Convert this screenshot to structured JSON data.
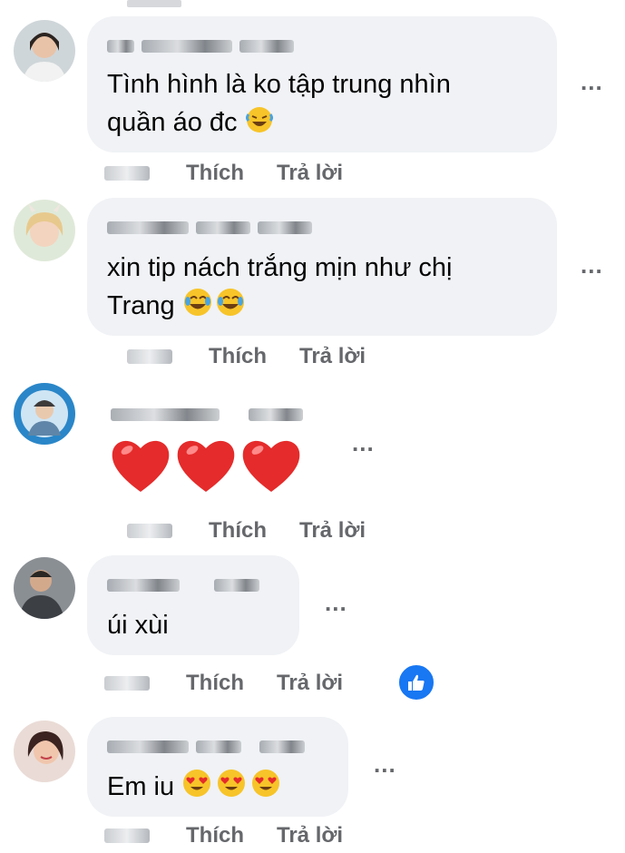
{
  "comments": [
    {
      "text_lines": [
        "Tình hình là ko tập trung nhìn",
        "quần áo đc"
      ],
      "emoji_end": "rofl",
      "actions": {
        "like": "Thích",
        "reply": "Trả lời"
      }
    },
    {
      "text_lines": [
        "xin tip nách trắng mịn như chị",
        "Trang"
      ],
      "emoji_end": "joy joy",
      "actions": {
        "like": "Thích",
        "reply": "Trả lời"
      }
    },
    {
      "text_lines": [],
      "emoji_end": "three hearts",
      "actions": {
        "like": "Thích",
        "reply": "Trả lời"
      }
    },
    {
      "text_lines": [
        "úi xùi"
      ],
      "actions": {
        "like": "Thích",
        "reply": "Trả lời"
      },
      "reaction": "like-icon"
    },
    {
      "text_lines": [
        "Em iu"
      ],
      "emoji_end": "three heart-eyes",
      "actions": {
        "like": "Thích",
        "reply": "Trả lời"
      }
    }
  ],
  "more_label": "...",
  "colors": {
    "bubble": "#f0f2f5",
    "meta": "#65676b",
    "like_blue": "#1877f2",
    "heart_red": "#e52b2b"
  }
}
